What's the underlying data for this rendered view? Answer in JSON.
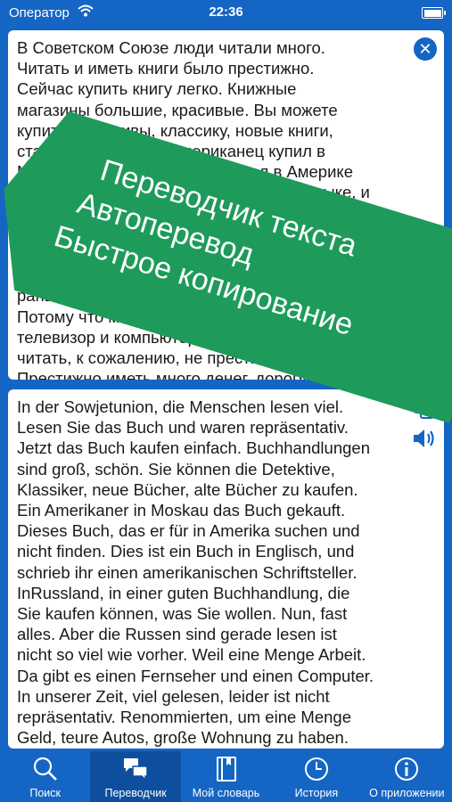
{
  "status_bar": {
    "carrier": "Оператор",
    "time": "22:36"
  },
  "source_panel": {
    "text": "В Советском Союзе люди читали много.\nЧитать и иметь книги было престижно.\nСейчас купить книгу легко. Книжные\nмагазины большие, красивые. Вы можете\nкупить детективы, классику, новые книги,\nстарые книги. Один американец купил в\nМоскве книгу. Эту книгу он искал в Америке\nи не нашёл. Эта книга на английском языке, и\nнаписал её американский писатель. В\nРоссии, в хорошем книжном магазине, вы\nможете купить всё, что хотите. Ну, почти всё.\nНо русские сейчас читают не так много, как\nраньше.\nПотому что много работают. Есть\nтелевизор и компьютер. В наше время\nчитать, к сожалению, не престижно.\nПрестижно иметь много денег, дорогую",
    "clear_icon": "close-circle-icon"
  },
  "promo": {
    "line1": "Переводчик текста",
    "line2": "Автоперевод",
    "line3": "Быстрое копирование",
    "color": "#1e9b5b"
  },
  "target_panel": {
    "text": "In der Sowjetunion, die Menschen lesen viel.\nLesen Sie das Buch und waren repräsentativ.\nJetzt das Buch kaufen einfach. Buchhandlungen\nsind groß, schön. Sie können die Detektive,\nKlassiker, neue Bücher, alte Bücher zu kaufen.\nEin Amerikaner in Moskau das Buch gekauft.\nDieses Buch, das er für in Amerika suchen und\nnicht finden. Dies ist ein Buch in Englisch, und\nschrieb ihr einen amerikanischen Schriftsteller.\nInRussland, in einer guten Buchhandlung, die\nSie kaufen können, was Sie wollen. Nun, fast\nalles. Aber die Russen sind gerade lesen ist\nnicht so viel wie vorher. Weil eine Menge Arbeit.\nDa gibt es einen Fernseher und einen Computer.\nIn unserer Zeit, viel gelesen, leider ist nicht\nrepräsentativ. Renommierten, um eine Menge\nGeld, teure Autos, große Wohnung zu haben.",
    "copy_icon": "copy-icon",
    "speak_icon": "speaker-icon"
  },
  "tabbar": {
    "tabs": [
      {
        "label": "Поиск",
        "icon": "search-icon",
        "active": false
      },
      {
        "label": "Переводчик",
        "icon": "chat-bubbles-icon",
        "active": true
      },
      {
        "label": "Мой словарь",
        "icon": "book-icon",
        "active": false
      },
      {
        "label": "История",
        "icon": "clock-icon",
        "active": false
      },
      {
        "label": "О приложении",
        "icon": "info-icon",
        "active": false
      }
    ]
  },
  "colors": {
    "accent": "#1565c4",
    "active_tab": "#0d4f9e",
    "promo": "#1e9b5b"
  }
}
